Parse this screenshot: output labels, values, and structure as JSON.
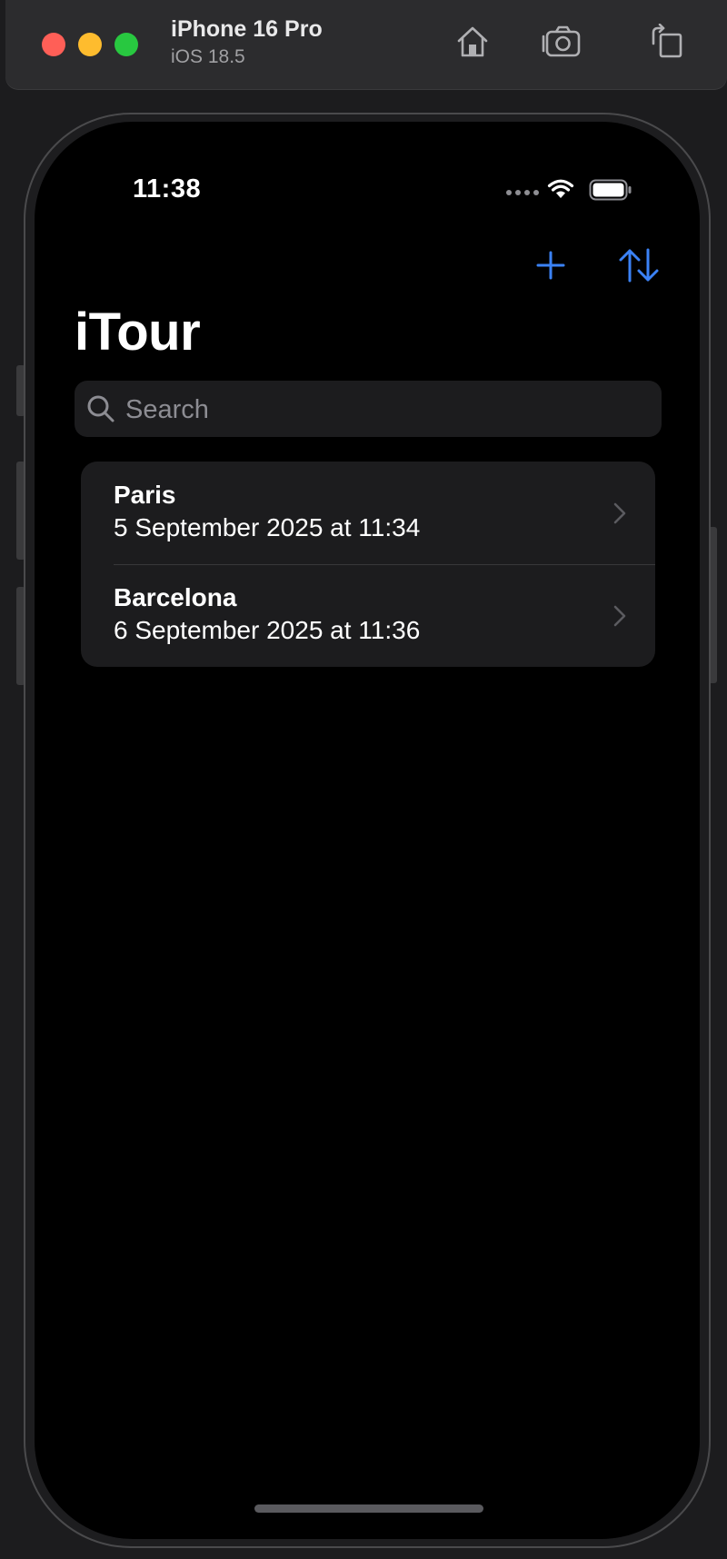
{
  "simulator": {
    "device_name": "iPhone 16 Pro",
    "os_version": "iOS 18.5",
    "toolbar_icons": [
      "home-icon",
      "screenshot-icon",
      "rotate-icon"
    ]
  },
  "status_bar": {
    "time": "11:38"
  },
  "nav": {
    "title": "iTour",
    "add_icon": "plus-icon",
    "sort_icon": "sort-arrows-icon"
  },
  "search": {
    "placeholder": "Search",
    "value": ""
  },
  "destinations": [
    {
      "name": "Paris",
      "date": "5 September 2025 at 11:34"
    },
    {
      "name": "Barcelona",
      "date": "6 September 2025 at 11:36"
    }
  ],
  "colors": {
    "accent": "#3b82f6",
    "background": "#000000",
    "cell_background": "#1c1c1e",
    "secondary_text": "#8d8d93"
  }
}
